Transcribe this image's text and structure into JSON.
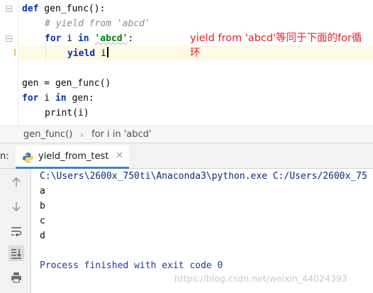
{
  "editor": {
    "lines": [
      {
        "def_kw": "def",
        "func_sig": " gen_func():"
      },
      {
        "comment": "# yield from 'abcd'"
      },
      {
        "for_kw": "for",
        "var": " i ",
        "in_kw": "in",
        "space": " ",
        "str": "'abcd'",
        "tail": ":"
      },
      {
        "yield_kw": "yield",
        "tail": " i"
      },
      {
        "assign": "gen = gen_func()"
      },
      {
        "for_kw": "for",
        "middle": " i ",
        "in_kw": "in",
        "tail": " gen:"
      },
      {
        "call": "print(i)"
      }
    ],
    "annotation": "yield from 'abcd'等同于下面的for循环"
  },
  "breadcrumb": {
    "items": [
      "gen_func()",
      "for i in 'abcd'"
    ],
    "separator": "›"
  },
  "run_panel": {
    "label": "n:",
    "tab_label": "yield_from_test",
    "close_glyph": "✕"
  },
  "console": {
    "command": "C:\\Users\\2600x_750ti\\Anaconda3\\python.exe C:/Users/2600x_75",
    "output": [
      "a",
      "b",
      "c",
      "d"
    ],
    "exit_message": "Process finished with exit code 0",
    "watermark": "https://blog.csdn.net/weixin_44024393"
  },
  "colors": {
    "keyword": "#0033b3",
    "string": "#067d17",
    "comment": "#8c8c8c",
    "annotation": "#e8202a",
    "current_line": "#fffae3",
    "tab_underline": "#4083c9"
  },
  "icons": [
    "fold-marker-icon",
    "python-file-icon",
    "rerun-up-icon",
    "down-arrow-icon",
    "soft-wrap-icon",
    "scroll-to-end-icon",
    "print-icon",
    "close-icon"
  ]
}
